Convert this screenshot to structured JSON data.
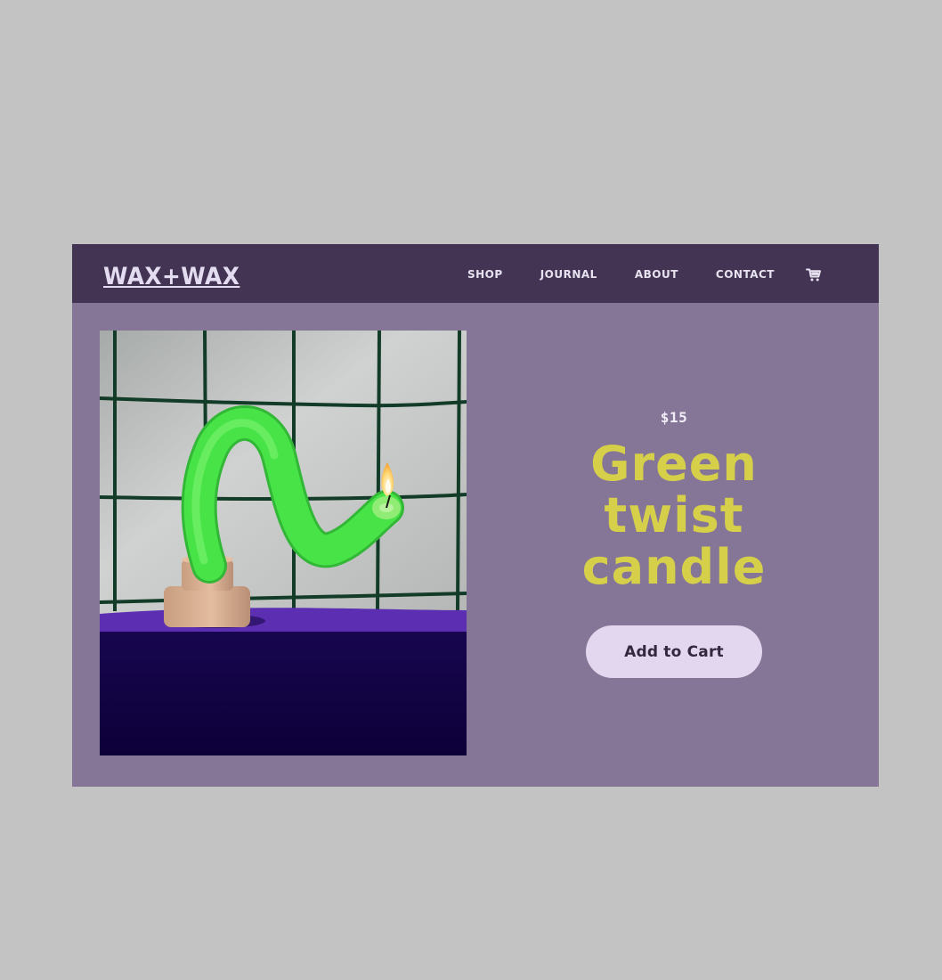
{
  "page": {
    "background_color": "#c3c3c3",
    "frame_background_color": "#857597"
  },
  "header": {
    "brand": "WAX+WAX",
    "background_color": "#433453",
    "nav": {
      "shop": "SHOP",
      "journal": "JOURNAL",
      "about": "ABOUT",
      "contact": "CONTACT"
    },
    "cart_icon": "shopping-cart-icon"
  },
  "product": {
    "image_icon": "green-twist-candle-photo",
    "price": "$15",
    "title_lines": [
      "Green",
      "twist",
      "candle"
    ],
    "add_to_cart_label": "Add to Cart",
    "title_color": "#d6cf4a",
    "button_color": "#e2d7ee",
    "image_colors": {
      "wall": "#c8cac9",
      "grid": "#1b4b35",
      "top_surface": "#5a2db0",
      "block": "#12034b",
      "candle": "#46de47",
      "holder": "#d8ad8f"
    }
  }
}
